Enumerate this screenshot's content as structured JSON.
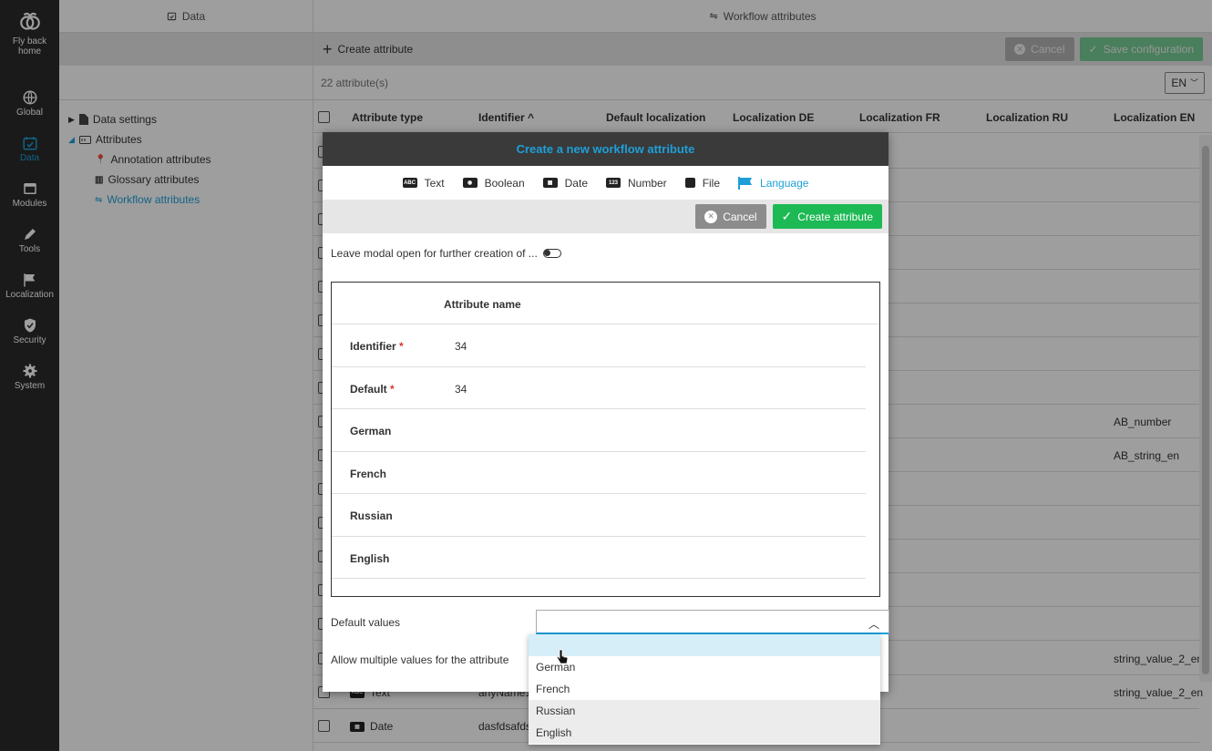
{
  "nav": {
    "items": [
      {
        "label": "Fly back home",
        "icon": "bee-icon"
      },
      {
        "label": "Global",
        "icon": "globe-icon"
      },
      {
        "label": "Data",
        "icon": "calendar-check-icon",
        "active": true
      },
      {
        "label": "Modules",
        "icon": "window-icon"
      },
      {
        "label": "Tools",
        "icon": "pencil-icon"
      },
      {
        "label": "Localization",
        "icon": "flag-icon"
      },
      {
        "label": "Security",
        "icon": "shield-icon"
      },
      {
        "label": "System",
        "icon": "gear-icon"
      }
    ]
  },
  "left_panel": {
    "title": "Data",
    "tree": [
      {
        "label": "Data settings"
      },
      {
        "label": "Attributes"
      },
      {
        "label": "Annotation attributes"
      },
      {
        "label": "Glossary attributes"
      },
      {
        "label": "Workflow attributes",
        "selected": true
      }
    ]
  },
  "main": {
    "title": "Workflow attributes",
    "create_label": "Create attribute",
    "cancel_label": "Cancel",
    "save_label": "Save configuration",
    "count": "22 attribute(s)",
    "lang": "EN",
    "columns": [
      "Attribute type",
      "Identifier ^",
      "Default localization",
      "Localization DE",
      "Localization FR",
      "Localization RU",
      "Localization EN"
    ],
    "rows_en": {
      "r9": "AB_number",
      "r10": "AB_string_en",
      "r15": "string_value_2_en",
      "r16": "string_value_2_en"
    },
    "row16": {
      "type": "Text",
      "identifier": "anyName1"
    },
    "row17": {
      "type": "Date",
      "identifier": "dasfdsafds"
    }
  },
  "modal": {
    "title": "Create a new workflow attribute",
    "types": [
      "Text",
      "Boolean",
      "Date",
      "Number",
      "File",
      "Language"
    ],
    "active_type": "Language",
    "cancel_label": "Cancel",
    "create_label": "Create attribute",
    "keep_open_label": "Leave modal open for further creation of ...",
    "loc_header": "Attribute name",
    "fields": [
      {
        "label": "Identifier",
        "required": true,
        "value": "34"
      },
      {
        "label": "Default",
        "required": true,
        "value": "34"
      },
      {
        "label": "German",
        "required": false,
        "value": ""
      },
      {
        "label": "French",
        "required": false,
        "value": ""
      },
      {
        "label": "Russian",
        "required": false,
        "value": ""
      },
      {
        "label": "English",
        "required": false,
        "value": ""
      }
    ],
    "default_values_label": "Default values",
    "multi_label": "Allow multiple values for the attribute",
    "dropdown_options": [
      "German",
      "French",
      "Russian",
      "English"
    ]
  }
}
